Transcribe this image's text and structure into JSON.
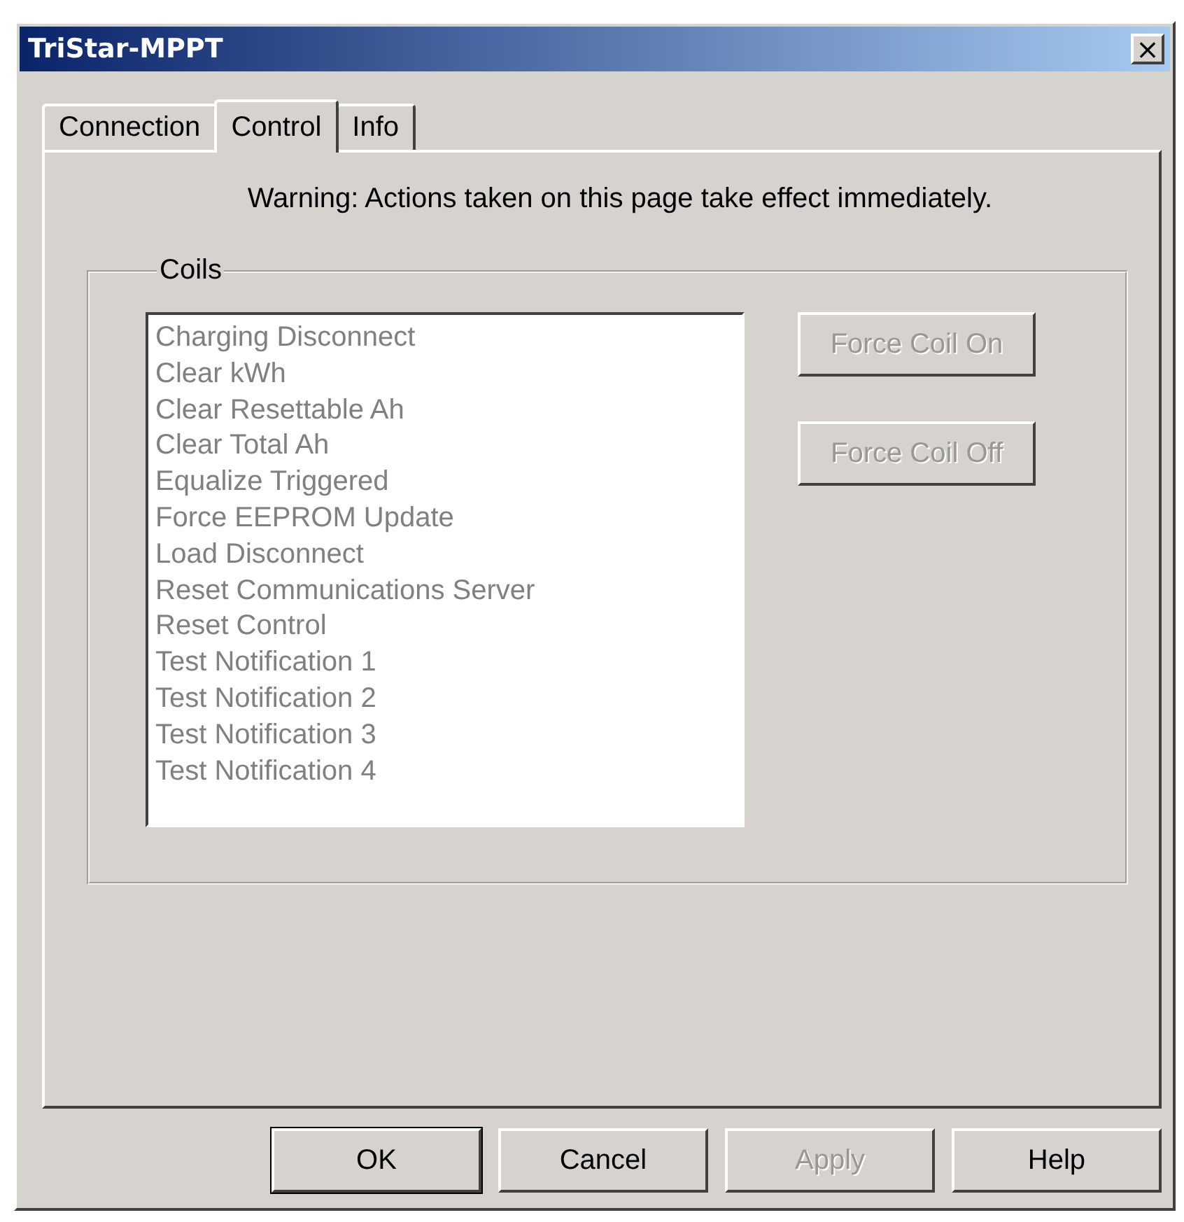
{
  "window": {
    "title": "TriStar-MPPT",
    "close": "×"
  },
  "tabs": [
    {
      "label": "Connection",
      "selected": false
    },
    {
      "label": "Control",
      "selected": true
    },
    {
      "label": "Info",
      "selected": false
    }
  ],
  "warning": "Warning: Actions taken on this page take effect immediately.",
  "coils": {
    "title": "Coils",
    "disabled": true,
    "items": [
      "Charging Disconnect",
      "Clear kWh",
      "Clear Resettable Ah",
      "Clear Total Ah",
      "Equalize Triggered",
      "Force EEPROM Update",
      "Load Disconnect",
      "Reset Communications Server",
      "Reset Control",
      "Test Notification 1",
      "Test Notification 2",
      "Test Notification 3",
      "Test Notification 4"
    ],
    "buttons": [
      {
        "label": "Force Coil On",
        "disabled": true
      },
      {
        "label": "Force Coil Off",
        "disabled": true
      }
    ]
  },
  "buttons": [
    {
      "label": "OK",
      "disabled": false,
      "default": true
    },
    {
      "label": "Cancel",
      "disabled": false,
      "default": false
    },
    {
      "label": "Apply",
      "disabled": true,
      "default": false
    },
    {
      "label": "Help",
      "disabled": false,
      "default": false
    }
  ]
}
